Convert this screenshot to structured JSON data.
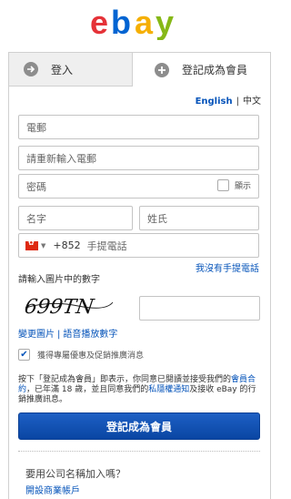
{
  "brand": {
    "logo_letters": [
      "e",
      "b",
      "a",
      "y"
    ],
    "logo_colors": [
      "#e53238",
      "#0064d2",
      "#f5af02",
      "#86b817"
    ]
  },
  "tabs": {
    "login_label": "登入",
    "register_label": "登記成為會員",
    "login_icon": "arrow-right-icon",
    "register_icon": "plus-icon"
  },
  "language": {
    "english": "English",
    "separator": "|",
    "chinese": "中文"
  },
  "form": {
    "email_placeholder": "電郵",
    "email_confirm_placeholder": "請重新輸入電郵",
    "password_placeholder": "密碼",
    "show_password_label": "顯示",
    "first_name_placeholder": "名字",
    "last_name_placeholder": "姓氏",
    "country_code": "+852",
    "phone_placeholder": "手提電話",
    "no_phone_link": "我沒有手提電話"
  },
  "captcha": {
    "label": "請輸入圖片中的數字",
    "image_text": "699TN",
    "change_image_link": "變更圖片",
    "link_separator": "|",
    "audio_link": "語音播放數字"
  },
  "promo": {
    "label": "獲得專屬優惠及促銷推廣消息",
    "checked": true
  },
  "terms": {
    "prefix": "按下「登記成為會員」即表示，你同意已閱讀並接受我們的",
    "user_agreement_link": "會員合約",
    "middle": "，已年滿 18 歲，並且同意我們的",
    "privacy_link": "私隱權通知",
    "suffix": "及接收 eBay 的行銷推廣訊息。"
  },
  "submit_label": "登記成為會員",
  "business": {
    "question": "要用公司名稱加入嗎？",
    "link": "開設商業帳戶"
  },
  "colors": {
    "link": "#0654ba",
    "button": "#0a46a3"
  }
}
